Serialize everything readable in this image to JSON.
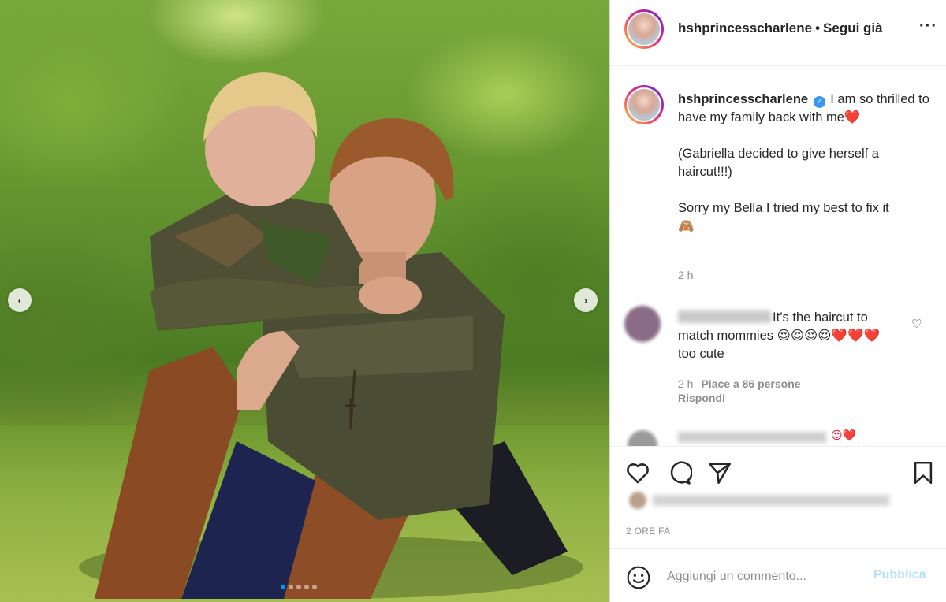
{
  "header": {
    "username": "hshprincesscharlene",
    "separator": "•",
    "follow_status": "Segui già",
    "more_icon": "more-options-icon"
  },
  "caption": {
    "username": "hshprincesscharlene",
    "verified_icon": "verified-badge-icon",
    "line1": "I am so thrilled to have my family back with me",
    "line1_emoji": "❤️",
    "line2": "(Gabriella decided to give herself a haircut!!!)",
    "line3": "Sorry my Bella I tried my best to fix it",
    "line3_emoji": "🙈",
    "time": "2 h"
  },
  "comment": {
    "text": "It’s the haircut to match mommies",
    "emojis": "😍😍😍😍❤️❤️❤️",
    "text_end": "too cute",
    "time": "2 h",
    "likes": "Piace a 86 persone",
    "reply": "Rispondi",
    "like_icon": "heart-outline-icon"
  },
  "comment2": {
    "emojis": "😍❤️"
  },
  "actions": {
    "like_icon": "heart-icon",
    "comment_icon": "comment-icon",
    "share_icon": "share-icon",
    "save_icon": "bookmark-icon"
  },
  "post_date": "2 ORE FA",
  "add_comment": {
    "placeholder": "Aggiungi un commento...",
    "publish": "Pubblica",
    "emoji_icon": "smiley-icon"
  },
  "carousel": {
    "prev_icon": "chevron-left-icon",
    "next_icon": "chevron-right-icon",
    "slide_count": 5,
    "active_slide": 1
  },
  "colors": {
    "accent": "#0095f6",
    "verified": "#3897f0",
    "heart": "#e0142a",
    "publish_disabled": "#b2dffc",
    "secondary_text": "#8e8e8e"
  }
}
